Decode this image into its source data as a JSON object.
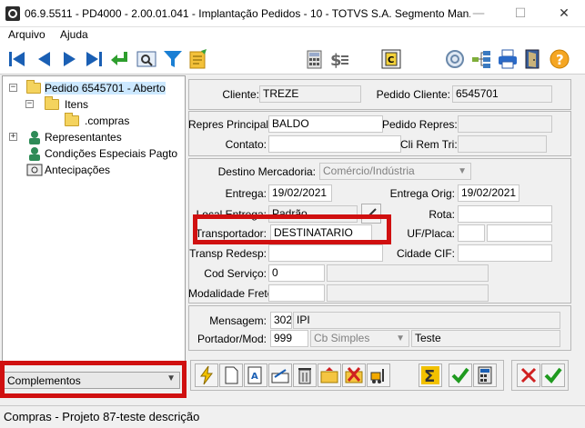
{
  "window": {
    "title": "06.9.5511 - PD4000 - 2.00.01.041 - Implantação Pedidos - 10 - TOTVS S.A. Segmento Man...",
    "minimize": "—",
    "maximize": "☐",
    "close": "✕"
  },
  "menu": {
    "file": "Arquivo",
    "help": "Ajuda"
  },
  "toolbar": {
    "icons": [
      "first-icon",
      "previous-icon",
      "next-icon",
      "last-icon",
      "goto-icon",
      "zoom-icon",
      "filter-icon",
      "search-list-icon",
      "calculator-icon",
      "price-icon",
      "copy-icon",
      "web-icon",
      "structure-icon",
      "print-icon",
      "exit-icon",
      "help-icon"
    ]
  },
  "tree": {
    "order": "Pedido 6545701 - Aberto",
    "items": "Itens",
    "compras": ".compras",
    "representantes": "Representantes",
    "condicoes": "Condições Especiais Pagto",
    "antecipacoes": "Antecipações"
  },
  "sidebar_combo": {
    "value": "Complementos"
  },
  "header": {
    "cliente_label": "Cliente:",
    "cliente_value": "TREZE",
    "pedido_label": "Pedido Cliente:",
    "pedido_value": "6545701"
  },
  "repres": {
    "principal_label": "Repres Principal:",
    "principal_value": "BALDO",
    "pedido_repres_label": "Pedido Repres:",
    "contato_label": "Contato:",
    "cli_rem_label": "Cli Rem Tri:"
  },
  "entrega": {
    "destino_label": "Destino Mercadoria:",
    "destino_value": "Comércio/Indústria",
    "entrega_label": "Entrega:",
    "entrega_value": "19/02/2021",
    "entrega_orig_label": "Entrega Orig:",
    "entrega_orig_value": "19/02/2021",
    "local_label": "Local Entrega:",
    "local_value": "Padrão",
    "rota_label": "Rota:",
    "transp_label": "Transportador:",
    "transp_value": "DESTINATARIO",
    "uf_label": "UF/Placa:",
    "redesp_label": "Transp Redesp:",
    "cidade_label": "Cidade CIF:",
    "cod_serv_label": "Cod Serviço:",
    "cod_serv_value": "0",
    "modalidade_label": "Modalidade Frete:"
  },
  "mensagem": {
    "mensagem_label": "Mensagem:",
    "mensagem_code": "302",
    "mensagem_value": "IPI",
    "portador_label": "Portador/Mod:",
    "portador_code": "999",
    "portador_mod": "Cb Simples",
    "portador_desc": "Teste"
  },
  "bottom_buttons": [
    "execute-icon",
    "new-icon",
    "edit-icon",
    "replace-icon",
    "delete-icon",
    "open-icon",
    "cancel-icon",
    "forklift-icon",
    "sum-icon",
    "confirm-icon",
    "calc-icon",
    "cancel-x-icon",
    "ok-check-icon"
  ],
  "status": {
    "text": "Compras - Projeto 87-teste descrição"
  },
  "colors": {
    "highlight": "#d01010",
    "accent": "#1a5fb4"
  }
}
